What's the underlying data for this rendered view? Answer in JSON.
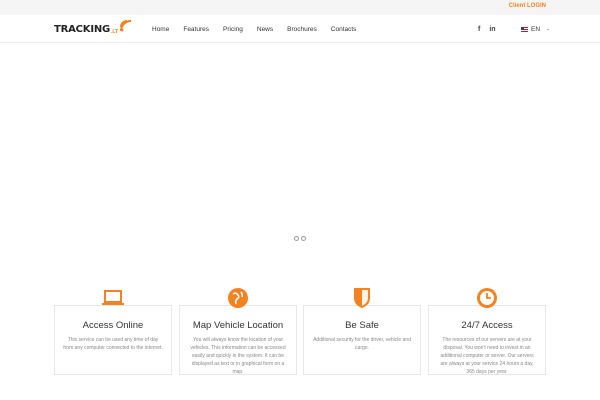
{
  "topbar": {
    "client_login": "Client LOGIN"
  },
  "brand": {
    "name": "TRACKING",
    "suffix": ".LT"
  },
  "nav": {
    "items": [
      {
        "label": "Home"
      },
      {
        "label": "Features"
      },
      {
        "label": "Pricing"
      },
      {
        "label": "News"
      },
      {
        "label": "Brochures"
      },
      {
        "label": "Contacts"
      }
    ]
  },
  "social": {
    "facebook": "f",
    "linkedin": "in"
  },
  "language": {
    "current": "EN",
    "caret": "⌄"
  },
  "colors": {
    "accent": "#f58220",
    "border": "#e6e6e6",
    "text": "#333333"
  },
  "features": [
    {
      "icon": "laptop-icon",
      "title": "Access Online",
      "text": "This service can be used any time of day from any computer connected to the internet."
    },
    {
      "icon": "globe-icon",
      "title": "Map Vehicle Location",
      "text": "You will always know the location of your vehicles. This information can be accessed easily and quickly in the system. It can be displayed as text or in graphical form on a map."
    },
    {
      "icon": "shield-icon",
      "title": "Be Safe",
      "text": "Additional security for the driver, vehicle and cargo."
    },
    {
      "icon": "clock-icon",
      "title": "24/7 Access",
      "text": "The resources of our servers are at your disposal. You won't need to invest in an additional computer or server. Our servers are always at your service 24 hours a day, 365 days per year."
    }
  ]
}
